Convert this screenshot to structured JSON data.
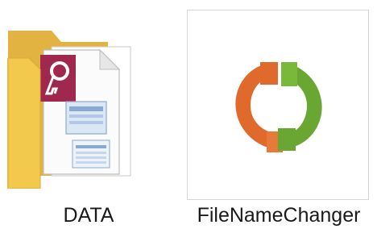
{
  "desktop": {
    "items": [
      {
        "label": "DATA",
        "icon": "folder-icon",
        "preview_icon": "access-database-icon"
      },
      {
        "label": "FileNameChanger",
        "icon": "circular-arrows-icon"
      }
    ]
  },
  "colors": {
    "folder_front": "#f2c94c",
    "folder_back": "#e3b341",
    "access_red": "#a0274e",
    "arrow_orange": "#e06a2c",
    "arrow_green": "#6aa632"
  }
}
